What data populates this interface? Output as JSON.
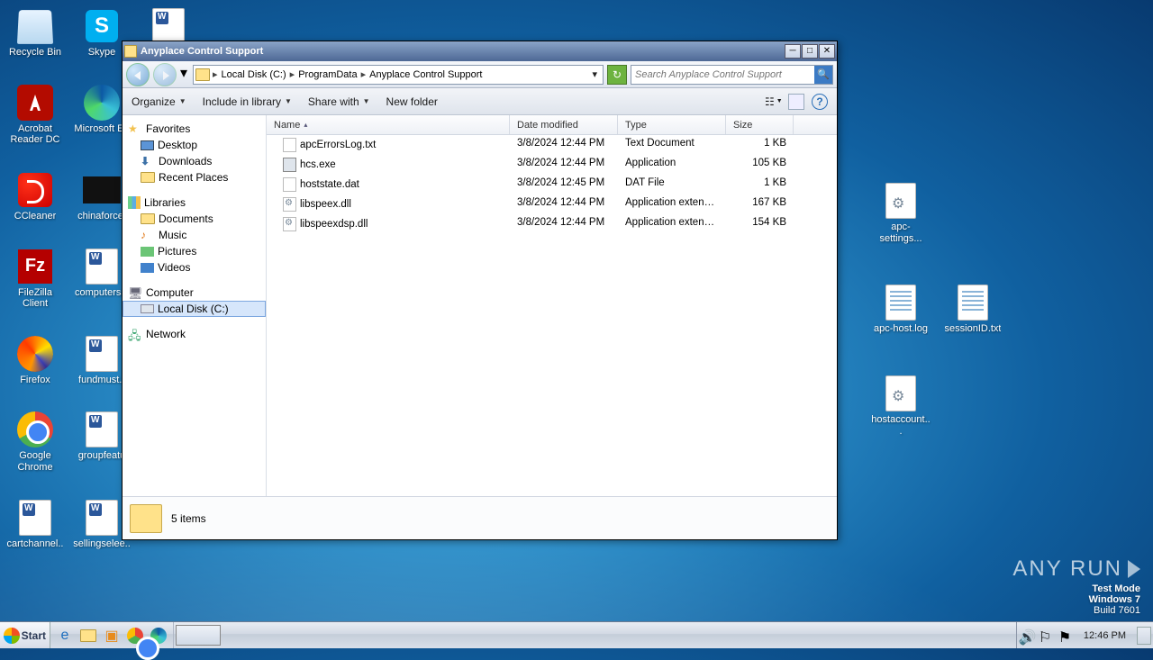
{
  "desktop_icons_left": [
    {
      "label": "Recycle Bin",
      "glyph": "bin"
    },
    {
      "label": "Skype",
      "glyph": "skype"
    },
    {
      "label": "",
      "glyph": "word"
    },
    {
      "label": "Acrobat Reader DC",
      "glyph": "acrobat"
    },
    {
      "label": "Microsoft Ed",
      "glyph": "edge"
    },
    {
      "label": "",
      "glyph": ""
    },
    {
      "label": "CCleaner",
      "glyph": "ccleaner"
    },
    {
      "label": "chinaforce.",
      "glyph": "black"
    },
    {
      "label": "",
      "glyph": ""
    },
    {
      "label": "FileZilla Client",
      "glyph": "filezilla"
    },
    {
      "label": "computersst",
      "glyph": "word"
    },
    {
      "label": "",
      "glyph": ""
    },
    {
      "label": "Firefox",
      "glyph": "firefox"
    },
    {
      "label": "fundmust.r",
      "glyph": "word"
    },
    {
      "label": "",
      "glyph": ""
    },
    {
      "label": "Google Chrome",
      "glyph": "chrome"
    },
    {
      "label": "groupfeatu",
      "glyph": "word"
    },
    {
      "label": "",
      "glyph": ""
    },
    {
      "label": "cartchannel..",
      "glyph": "word"
    },
    {
      "label": "sellingselee..",
      "glyph": "word"
    },
    {
      "label": "",
      "glyph": ""
    }
  ],
  "desktop_icons_right": [
    {
      "label": "apc-settings...",
      "glyph": "gear-doc"
    },
    {
      "label": "",
      "glyph": ""
    },
    {
      "label": "apc-host.log",
      "glyph": "txt"
    },
    {
      "label": "sessionID.txt",
      "glyph": "txt"
    },
    {
      "label": "hostaccount...",
      "glyph": "gear-doc"
    },
    {
      "label": "",
      "glyph": ""
    }
  ],
  "window": {
    "title": "Anyplace Control Support",
    "breadcrumb": [
      "Local Disk (C:)",
      "ProgramData",
      "Anyplace Control Support"
    ],
    "search_placeholder": "Search Anyplace Control Support",
    "toolbar": {
      "organize": "Organize",
      "include": "Include in library",
      "share": "Share with",
      "newfolder": "New folder"
    },
    "nav": {
      "favorites": {
        "hdr": "Favorites",
        "items": [
          "Desktop",
          "Downloads",
          "Recent Places"
        ]
      },
      "libraries": {
        "hdr": "Libraries",
        "items": [
          "Documents",
          "Music",
          "Pictures",
          "Videos"
        ]
      },
      "computer": {
        "hdr": "Computer",
        "items": [
          "Local Disk (C:)"
        ]
      },
      "network": {
        "hdr": "Network"
      }
    },
    "columns": {
      "name": "Name",
      "date": "Date modified",
      "type": "Type",
      "size": "Size"
    },
    "files": [
      {
        "name": "apcErrorsLog.txt",
        "date": "3/8/2024 12:44 PM",
        "type": "Text Document",
        "size": "1 KB",
        "ic": "txt"
      },
      {
        "name": "hcs.exe",
        "date": "3/8/2024 12:44 PM",
        "type": "Application",
        "size": "105 KB",
        "ic": "exe"
      },
      {
        "name": "hoststate.dat",
        "date": "3/8/2024 12:45 PM",
        "type": "DAT File",
        "size": "1 KB",
        "ic": "dat"
      },
      {
        "name": "libspeex.dll",
        "date": "3/8/2024 12:44 PM",
        "type": "Application extension",
        "size": "167 KB",
        "ic": "dll"
      },
      {
        "name": "libspeexdsp.dll",
        "date": "3/8/2024 12:44 PM",
        "type": "Application extension",
        "size": "154 KB",
        "ic": "dll"
      }
    ],
    "status": "5 items"
  },
  "watermark": {
    "l1": "Test Mode",
    "l2": "Windows 7",
    "l3": "Build 7601"
  },
  "anyrun": "ANY   RUN",
  "taskbar": {
    "start": "Start",
    "clock": "12:46 PM"
  }
}
